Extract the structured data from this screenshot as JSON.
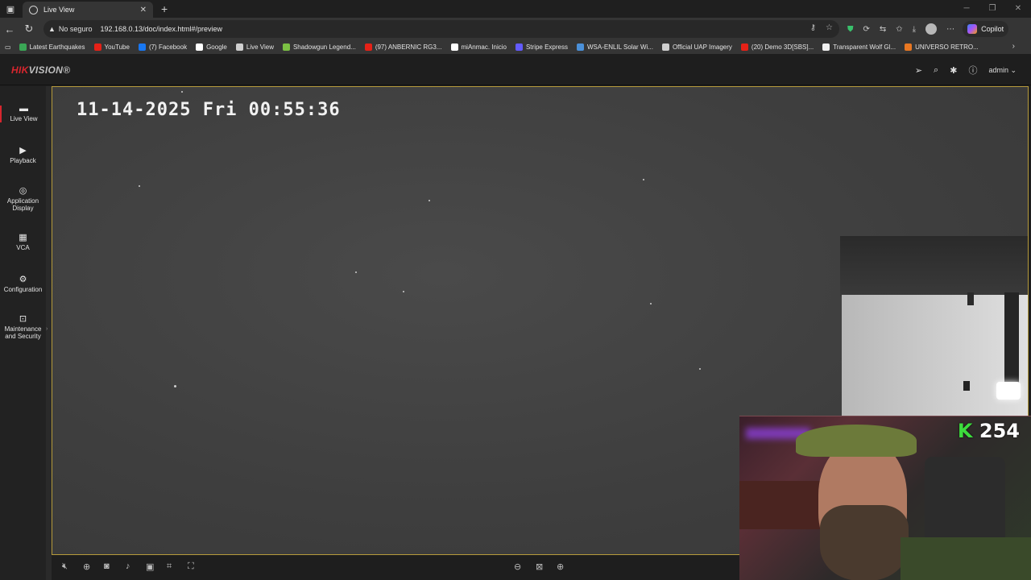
{
  "browser": {
    "tab_title": "Live View",
    "new_tab": "+",
    "address": {
      "security_label": "No seguro",
      "url": "192.168.0.13/doc/index.html#/preview"
    },
    "copilot_label": "Copilot",
    "bookmarks": [
      {
        "label": "Latest Earthquakes",
        "color": "#3aa655"
      },
      {
        "label": "YouTube",
        "color": "#e62117"
      },
      {
        "label": "(7) Facebook",
        "color": "#1877f2"
      },
      {
        "label": "Google",
        "color": "#ffffff"
      },
      {
        "label": "Live View",
        "color": "#cfcfcf"
      },
      {
        "label": "Shadowgun Legend...",
        "color": "#7bc043"
      },
      {
        "label": "(97) ANBERNIC RG3...",
        "color": "#e62117"
      },
      {
        "label": "miAnmac. Inicio",
        "color": "#ffffff"
      },
      {
        "label": "Stripe Express",
        "color": "#635bff"
      },
      {
        "label": "WSA-ENLIL Solar Wi...",
        "color": "#4a90d9"
      },
      {
        "label": "Official UAP Imagery",
        "color": "#cfcfcf"
      },
      {
        "label": "(20) Demo 3D[SBS]...",
        "color": "#e62117"
      },
      {
        "label": "Transparent Wolf Gl...",
        "color": "#f0f0f0"
      },
      {
        "label": "UNIVERSO RETRO...",
        "color": "#e87722"
      }
    ]
  },
  "app": {
    "brand": {
      "red": "HIK",
      "grey": "VISION"
    },
    "user": "admin",
    "nav": [
      {
        "label": "Live View",
        "icon": "live-view-icon",
        "active": true
      },
      {
        "label": "Playback",
        "icon": "playback-icon"
      },
      {
        "label": "Application Display",
        "icon": "application-icon"
      },
      {
        "label": "VCA",
        "icon": "vca-icon"
      },
      {
        "label": "Configuration",
        "icon": "gear-icon"
      },
      {
        "label": "Maintenance and Security",
        "icon": "maintenance-icon"
      }
    ]
  },
  "video": {
    "osd_timestamp": "11-14-2025 Fri 00:55:36",
    "frame_border_color": "#b59a3b"
  },
  "stream_overlay": {
    "kick_letter": "K",
    "count": "254"
  }
}
